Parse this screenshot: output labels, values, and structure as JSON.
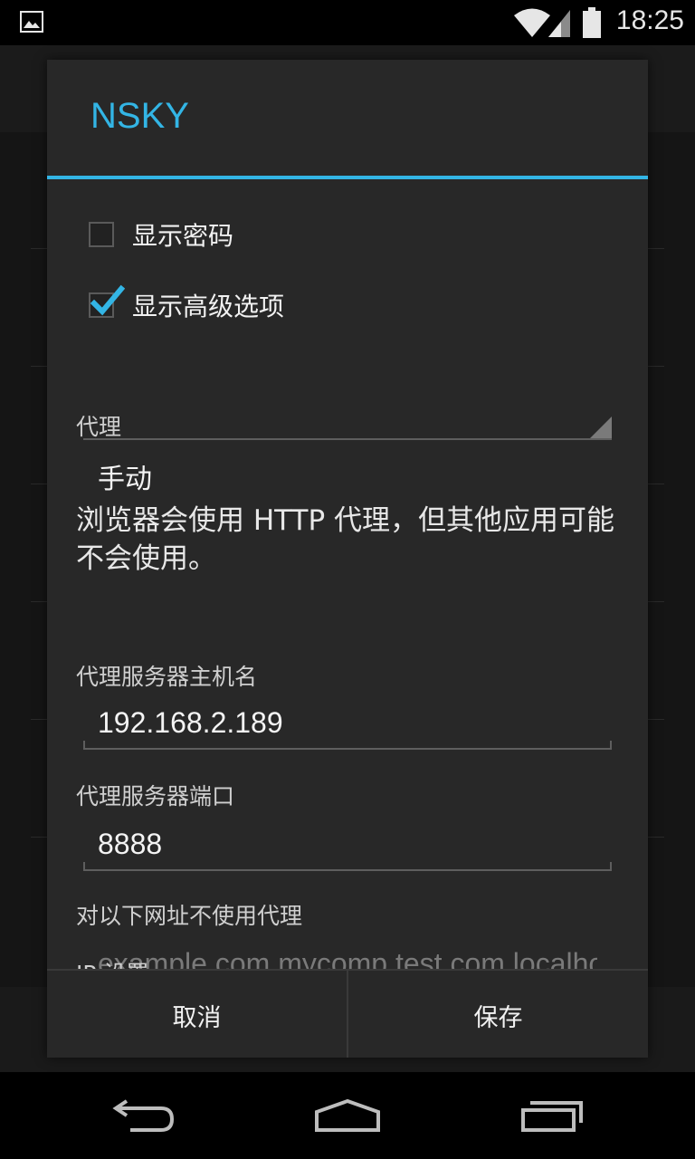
{
  "status_bar": {
    "time": "18:25",
    "icons": [
      "gallery-icon",
      "wifi-icon",
      "signal-icon",
      "battery-icon"
    ]
  },
  "dialog": {
    "title": "NSKY",
    "show_password": {
      "label": "显示密码",
      "checked": false
    },
    "show_advanced": {
      "label": "显示高级选项",
      "checked": true
    },
    "proxy": {
      "label": "代理",
      "value": "手动"
    },
    "proxy_note": "浏览器会使用 HTTP 代理，但其他应用可能不会使用。",
    "proxy_host": {
      "label": "代理服务器主机名",
      "value": "192.168.2.189"
    },
    "proxy_port": {
      "label": "代理服务器端口",
      "value": "8888"
    },
    "bypass": {
      "label": "对以下网址不使用代理",
      "placeholder": "example.com,mycomp.test.com,localhost"
    },
    "ip_settings_label": "IP 设置",
    "buttons": {
      "cancel": "取消",
      "save": "保存"
    }
  },
  "colors": {
    "accent": "#33b5e5",
    "dialog_bg": "#282828",
    "text": "#f2f2f2"
  },
  "nav_bar": {
    "icons": [
      "back-icon",
      "home-icon",
      "recents-icon"
    ]
  }
}
